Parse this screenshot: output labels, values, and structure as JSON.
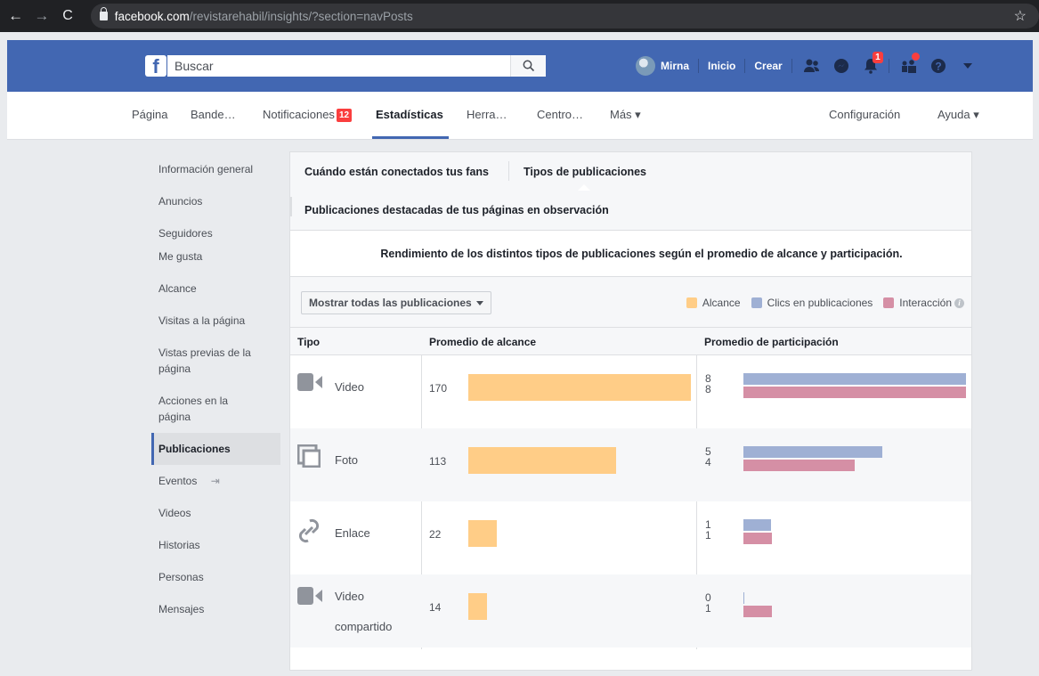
{
  "browser": {
    "url_host": "facebook.com",
    "url_path": "/revistarehabil/insights/?section=navPosts"
  },
  "topbar": {
    "logo": "f",
    "search_placeholder": "Buscar",
    "user_name": "Mirna",
    "home_label": "Inicio",
    "create_label": "Crear",
    "notifications_badge": "1"
  },
  "page_nav": {
    "items": [
      "Página",
      "Bande…",
      "Notificaciones",
      "Estadísticas",
      "Herra…",
      "Centro…",
      "Más ▾",
      "Configuración",
      "Ayuda ▾"
    ],
    "notifications_count": "12"
  },
  "sidebar": {
    "items": [
      "Información general",
      "Anuncios",
      "Seguidores",
      "Me gusta",
      "Alcance",
      "Visitas a la página",
      "Vistas previas de la página",
      "Acciones en la página",
      "Publicaciones",
      "Eventos",
      "Videos",
      "Historias",
      "Personas",
      "Mensajes"
    ],
    "active": "Publicaciones"
  },
  "tabs": {
    "tab1": "Cuándo están conectados tus fans",
    "tab2": "Tipos de publicaciones",
    "tab3": "Publicaciones destacadas de tus páginas en observación"
  },
  "description": "Rendimiento de los distintos tipos de publicaciones según el promedio de alcance y participación.",
  "filter": {
    "dropdown_label": "Mostrar todas las publicaciones"
  },
  "legend": {
    "reach": "Alcance",
    "clicks": "Clics en publicaciones",
    "interaction": "Interacción",
    "colors": {
      "reach": "#ffcd87",
      "clicks": "#9fb0d4",
      "interaction": "#d58fa5"
    }
  },
  "table": {
    "headers": {
      "type": "Tipo",
      "reach": "Promedio de alcance",
      "engagement": "Promedio de participación"
    },
    "rows": [
      {
        "type": "Video",
        "icon": "video-camera-icon",
        "reach": 170,
        "clicks": 8,
        "interaction": 8
      },
      {
        "type": "Foto",
        "icon": "photo-icon",
        "reach": 113,
        "clicks": 5,
        "interaction": 4
      },
      {
        "type": "Enlace",
        "icon": "link-icon",
        "reach": 22,
        "clicks": 1,
        "interaction": 1
      },
      {
        "type": "Video compartido",
        "icon": "video-camera-icon",
        "reach": 14,
        "clicks": 0,
        "interaction": 1
      }
    ]
  }
}
